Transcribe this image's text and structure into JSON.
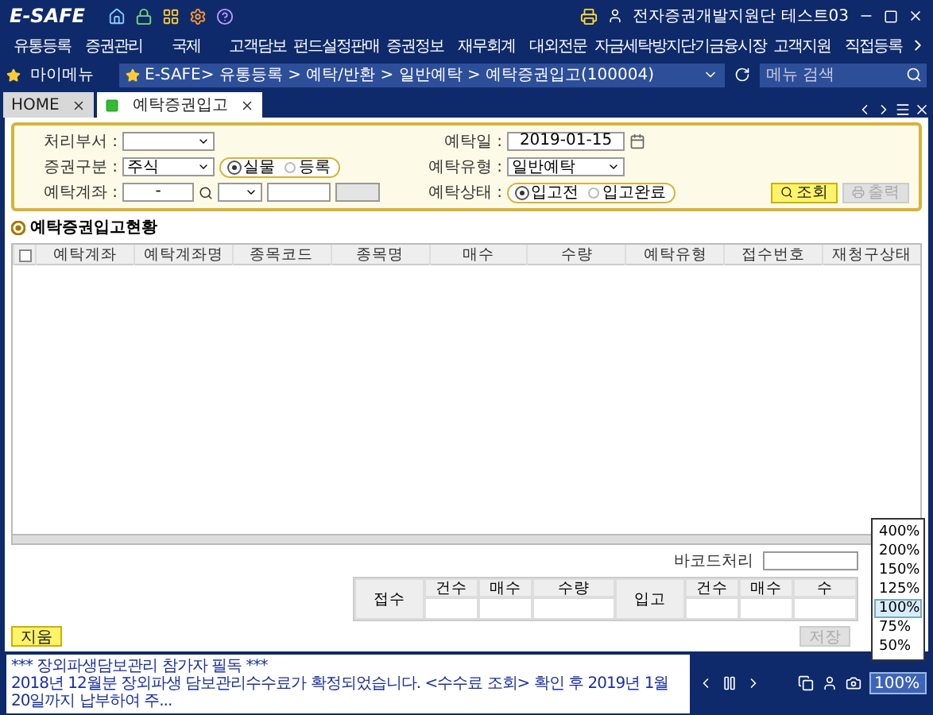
{
  "app": {
    "logo": "E-SAFE",
    "user": "전자증권개발지원단 테스트03"
  },
  "menu": [
    "유통등록",
    "증권관리",
    "국제",
    "고객담보",
    "펀드설정판매",
    "증권정보",
    "재무회계",
    "대외전문",
    "자금세탁방지",
    "단기금융시장",
    "고객지원",
    "직접등록"
  ],
  "breadcrumb": {
    "my_menu": "마이메뉴",
    "path": "E-SAFE> 유통등록 > 예탁/반환 > 일반예탁 > 예탁증권입고(100004)",
    "search_placeholder": "메뉴 검색"
  },
  "tabs": [
    {
      "label": "HOME",
      "selected": false
    },
    {
      "label": "예탁증권입고",
      "selected": true
    }
  ],
  "filters": {
    "department": {
      "label": "처리부서 :"
    },
    "security_type": {
      "label": "증권구분 :",
      "value": "주식"
    },
    "form_radios": [
      {
        "label": "실물",
        "selected": true
      },
      {
        "label": "등록",
        "selected": false
      }
    ],
    "account": {
      "label": "예탁계좌 :",
      "value": "-"
    },
    "date": {
      "label": "예탁일 :",
      "value": "2019-01-15"
    },
    "deposit_type": {
      "label": "예탁유형 :",
      "value": "일반예탁"
    },
    "status_label": "예탁상태 :",
    "status_radios": [
      {
        "label": "입고전",
        "selected": true
      },
      {
        "label": "입고완료",
        "selected": false
      }
    ],
    "buttons": [
      {
        "label": "조회",
        "disabled": false
      },
      {
        "label": "출력",
        "disabled": true
      }
    ]
  },
  "section_title": "예탁증권입고현황",
  "grid": {
    "select_all_checked": false,
    "columns": [
      "예탁계좌",
      "예탁계좌명",
      "종목코드",
      "종목명",
      "매수",
      "수량",
      "예탁유형",
      "접수번호",
      "재청구상태"
    ]
  },
  "barcode": {
    "label": "바코드처리"
  },
  "summary": [
    {
      "label": "접수",
      "columns": [
        "건수",
        "매수",
        "수량"
      ]
    },
    {
      "label": "입고",
      "columns": [
        "건수",
        "매수",
        "수"
      ]
    }
  ],
  "bottom_buttons": [
    {
      "label": "지움",
      "disabled": false
    },
    {
      "label": "저장",
      "disabled": true
    }
  ],
  "ticker": [
    "*** 장외파생담보관리 참가자 필독 ***",
    "2018년 12월분 장외파생 담보관리수수료가 확정되었습니다. <수수료 조회> 확인 후 2019년 1월 20일까지 납부하여 주..."
  ],
  "zoom": {
    "value": "100%",
    "expanded": true,
    "options": [
      {
        "label": "400%",
        "selected": false
      },
      {
        "label": "200%",
        "selected": false
      },
      {
        "label": "150%",
        "selected": false
      },
      {
        "label": "125%",
        "selected": false
      },
      {
        "label": "100%",
        "selected": true
      },
      {
        "label": "75%",
        "selected": false
      },
      {
        "label": "50%",
        "selected": false
      }
    ]
  }
}
